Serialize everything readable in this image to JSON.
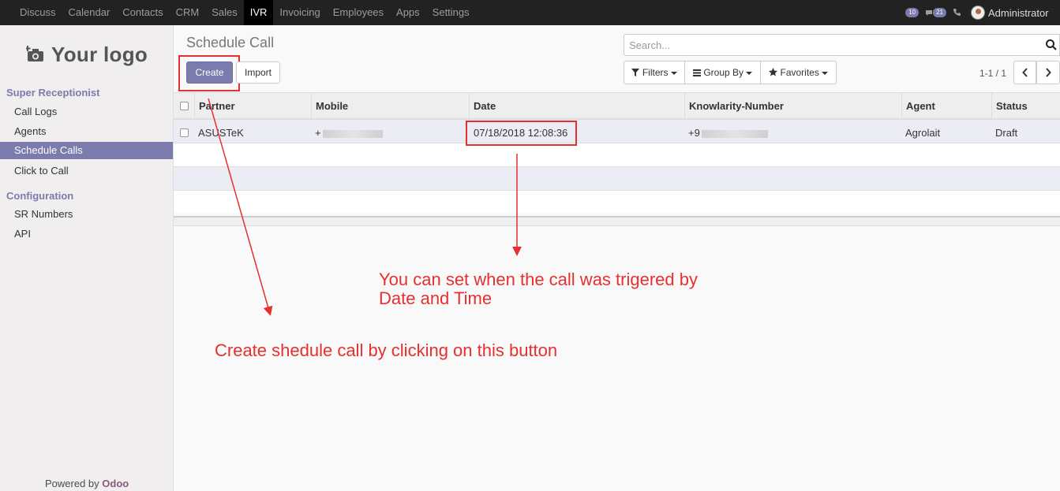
{
  "navbar": {
    "menu": [
      "Discuss",
      "Calendar",
      "Contacts",
      "CRM",
      "Sales",
      "IVR",
      "Invoicing",
      "Employees",
      "Apps",
      "Settings"
    ],
    "active": "IVR",
    "badges": {
      "activities": "10",
      "messages": "21"
    },
    "user": "Administrator"
  },
  "sidebar": {
    "logo_text": "Your logo",
    "section1": "Super Receptionist",
    "items1": [
      "Call Logs",
      "Agents",
      "Schedule Calls",
      "Click to Call"
    ],
    "active_item": "Schedule Calls",
    "section2": "Configuration",
    "items2": [
      "SR Numbers",
      "API"
    ],
    "powered_by": "Powered by",
    "powered_brand": "Odoo"
  },
  "control_panel": {
    "title": "Schedule Call",
    "create_label": "Create",
    "import_label": "Import",
    "search_placeholder": "Search...",
    "filters_label": "Filters",
    "groupby_label": "Group By",
    "favorites_label": "Favorites",
    "pager_text": "1-1 / 1"
  },
  "table": {
    "columns": [
      "Partner",
      "Mobile",
      "Date",
      "Knowlarity-Number",
      "Agent",
      "Status"
    ],
    "rows": [
      {
        "partner": "ASUSTeK",
        "mobile": "+",
        "date": "07/18/2018 12:08:36",
        "knowlarity": "+9",
        "agent": "Agrolait",
        "status": "Draft"
      }
    ]
  },
  "annotations": {
    "date_note_line1": "You can set when the call was trigered by",
    "date_note_line2": "Date and Time",
    "create_note": "Create shedule call by clicking on this button"
  },
  "colors": {
    "accent": "#7c7bad",
    "annotation": "#e53030",
    "navbar_bg": "#222222"
  }
}
